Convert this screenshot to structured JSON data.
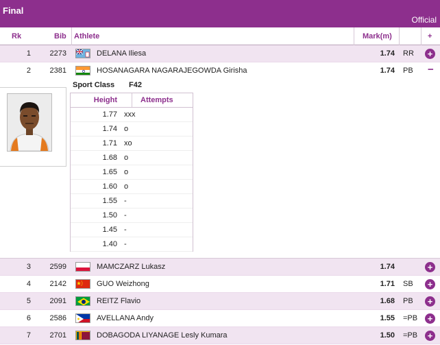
{
  "header": {
    "title": "Final",
    "status": "Official"
  },
  "columns": {
    "rank": "Rk",
    "bib": "Bib",
    "athlete": "Athlete",
    "mark": "Mark(m)",
    "plus": "+"
  },
  "expanded": {
    "sport_class_label": "Sport Class",
    "sport_class": "F42",
    "height_header": "Height",
    "attempts_header": "Attempts"
  },
  "rows": [
    {
      "rank": "1",
      "bib": "2273",
      "country_flag": "fiji-flag",
      "athlete": "DELANA Iliesa",
      "mark": "1.74",
      "record": "RR",
      "toggle": "+"
    },
    {
      "rank": "2",
      "bib": "2381",
      "country_flag": "india-flag",
      "athlete": "HOSANAGARA NAGARAJEGOWDA Girisha",
      "mark": "1.74",
      "record": "PB",
      "toggle": "−"
    },
    {
      "rank": "3",
      "bib": "2599",
      "country_flag": "poland-flag",
      "athlete": "MAMCZARZ Lukasz",
      "mark": "1.74",
      "record": "",
      "toggle": "+"
    },
    {
      "rank": "4",
      "bib": "2142",
      "country_flag": "china-flag",
      "athlete": "GUO Weizhong",
      "mark": "1.71",
      "record": "SB",
      "toggle": "+"
    },
    {
      "rank": "5",
      "bib": "2091",
      "country_flag": "brazil-flag",
      "athlete": "REITZ Flavio",
      "mark": "1.68",
      "record": "PB",
      "toggle": "+"
    },
    {
      "rank": "6",
      "bib": "2586",
      "country_flag": "philippines-flag",
      "athlete": "AVELLANA Andy",
      "mark": "1.55",
      "record": "=PB",
      "toggle": "+"
    },
    {
      "rank": "7",
      "bib": "2701",
      "country_flag": "sri-lanka-flag",
      "athlete": "DOBAGODA LIYANAGE Lesly Kumara",
      "mark": "1.50",
      "record": "=PB",
      "toggle": "+"
    }
  ],
  "attempts": [
    {
      "height": "1.77",
      "result": "xxx"
    },
    {
      "height": "1.74",
      "result": "o"
    },
    {
      "height": "1.71",
      "result": "xo"
    },
    {
      "height": "1.68",
      "result": "o"
    },
    {
      "height": "1.65",
      "result": "o"
    },
    {
      "height": "1.60",
      "result": "o"
    },
    {
      "height": "1.55",
      "result": "-"
    },
    {
      "height": "1.50",
      "result": "-"
    },
    {
      "height": "1.45",
      "result": "-"
    },
    {
      "height": "1.40",
      "result": "-"
    }
  ]
}
